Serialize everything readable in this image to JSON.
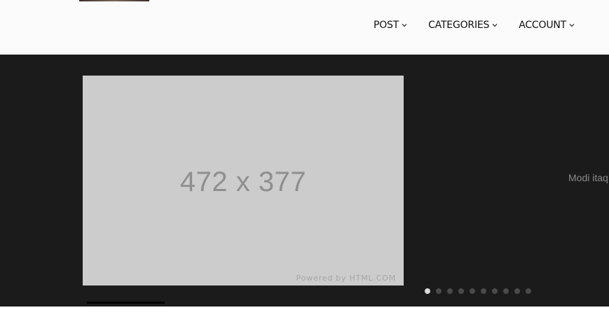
{
  "nav": {
    "items": [
      {
        "label": "POST",
        "icon": "chevron-down-icon"
      },
      {
        "label": "CATEGORIES",
        "icon": "chevron-down-icon"
      },
      {
        "label": "ACCOUNT",
        "icon": "chevron-down-icon"
      }
    ]
  },
  "slider": {
    "placeholder_text": "472 x 377",
    "placeholder_credit": "Powered by HTML.COM",
    "slide_text": "Modi itaq",
    "dots_total": 10,
    "active_dot": 0,
    "colors": {
      "background": "#1b1b1b",
      "placeholder": "#cccccc",
      "dot_active": "#d9d9d9",
      "dot_inactive": "#4a4a4a"
    }
  }
}
